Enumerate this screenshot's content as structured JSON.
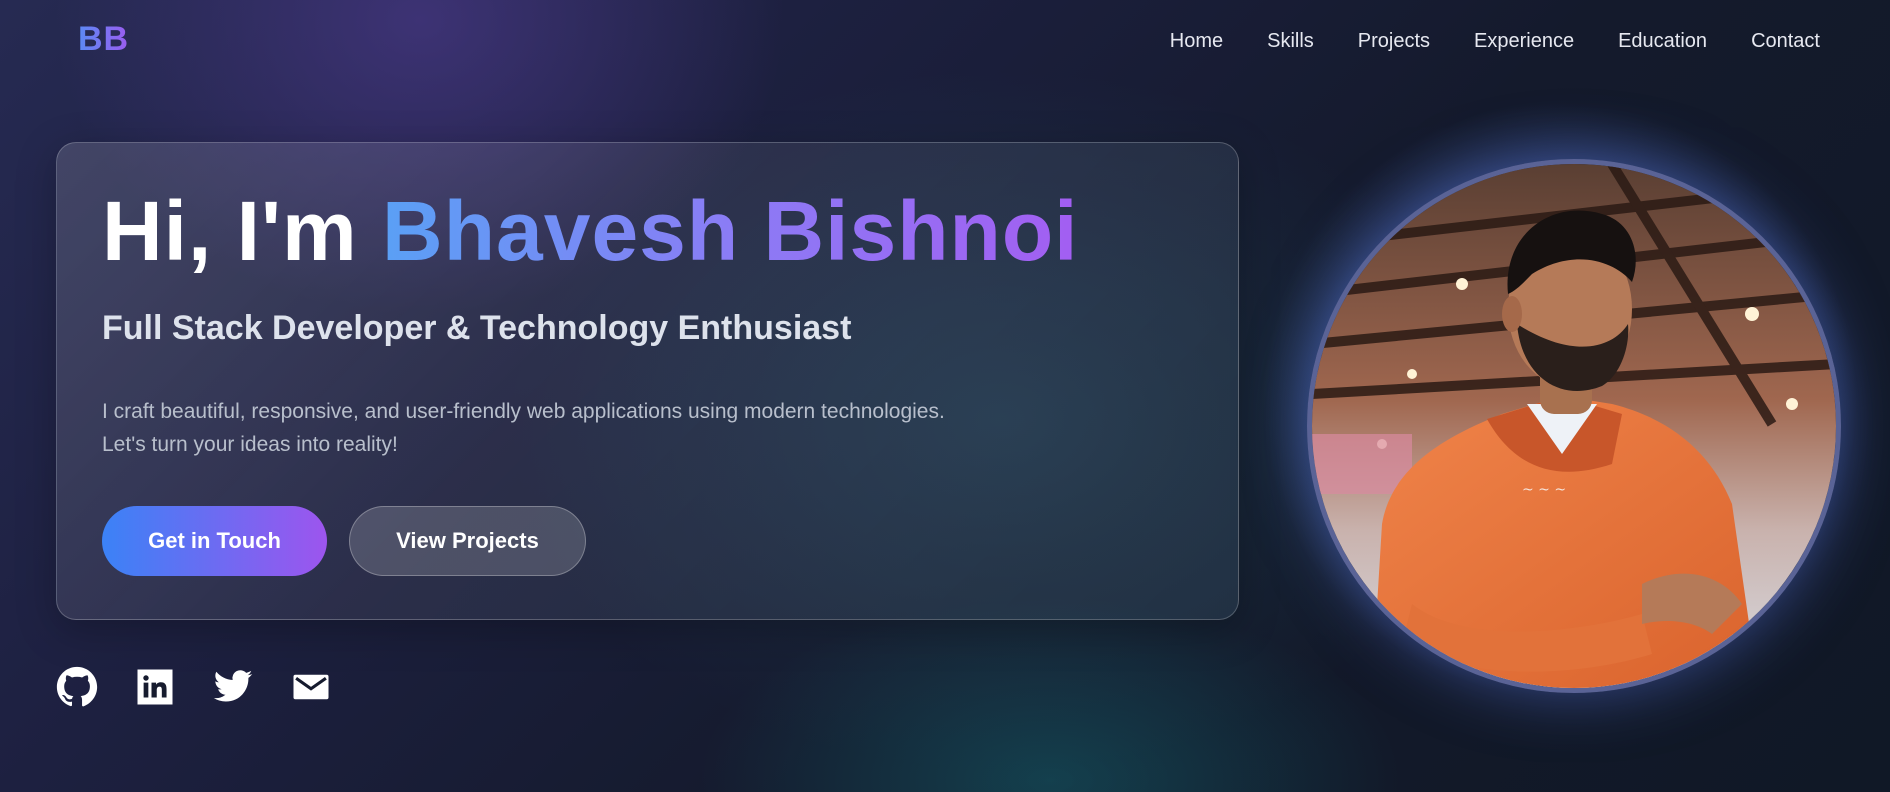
{
  "nav": {
    "logo": "BB",
    "links": [
      "Home",
      "Skills",
      "Projects",
      "Experience",
      "Education",
      "Contact"
    ]
  },
  "hero": {
    "greeting_prefix": "Hi, I'm",
    "name": "Bhavesh Bishnoi",
    "subtitle": "Full Stack Developer & Technology Enthusiast",
    "description_line1": "I craft beautiful, responsive, and user-friendly web applications using modern technologies.",
    "description_line2": "Let's turn your ideas into reality!",
    "primary_button": "Get in Touch",
    "secondary_button": "View Projects"
  },
  "socials": [
    {
      "icon": "github-icon"
    },
    {
      "icon": "linkedin-icon"
    },
    {
      "icon": "twitter-icon"
    },
    {
      "icon": "mail-icon"
    }
  ],
  "colors": {
    "accent_blue": "#3b82f6",
    "accent_purple": "#9d55ee",
    "background": "#111827"
  }
}
